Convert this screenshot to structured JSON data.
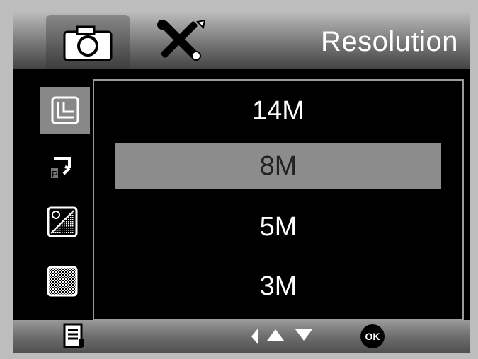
{
  "header": {
    "title": "Resolution",
    "tabs": [
      {
        "icon": "camera-icon",
        "active": true
      },
      {
        "icon": "tools-icon",
        "active": false
      }
    ]
  },
  "sidebar": {
    "items": [
      {
        "icon": "resolution-icon",
        "active": true
      },
      {
        "icon": "playback-icon",
        "active": false
      },
      {
        "icon": "exposure-icon",
        "active": false
      },
      {
        "icon": "quality-icon",
        "active": false
      }
    ]
  },
  "menu": {
    "options": [
      "14M",
      "8M",
      "5M",
      "3M"
    ],
    "selected": "8M"
  },
  "footer": {
    "icons": [
      "menu-icon",
      "left-arrow-icon",
      "up-arrow-icon",
      "down-arrow-icon",
      "ok-icon"
    ],
    "ok_label": "OK"
  },
  "colors": {
    "highlight": "#8c8c8c",
    "background": "#000000",
    "text": "#ffffff"
  }
}
